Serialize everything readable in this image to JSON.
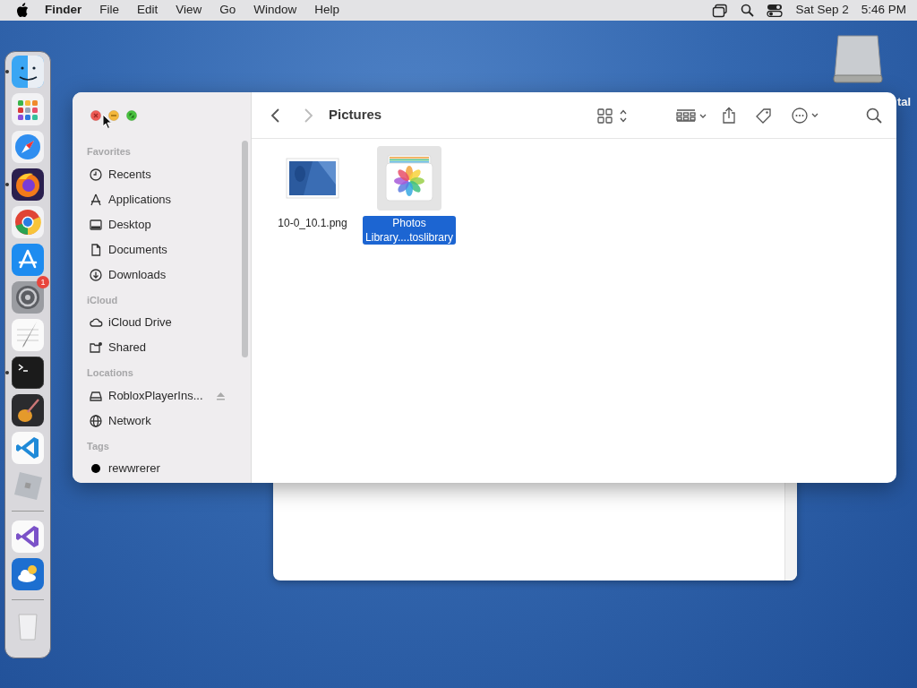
{
  "menu_bar": {
    "app_name": "Finder",
    "menus": [
      "File",
      "Edit",
      "View",
      "Go",
      "Window",
      "Help"
    ],
    "date": "Sat Sep 2",
    "time": "5:46 PM"
  },
  "dock": {
    "items": [
      {
        "kind": "finder",
        "running": true
      },
      {
        "kind": "launchpad",
        "running": false
      },
      {
        "kind": "safari",
        "running": false
      },
      {
        "kind": "firefox",
        "running": true
      },
      {
        "kind": "chrome",
        "running": false
      },
      {
        "kind": "appstore",
        "running": false
      },
      {
        "kind": "settings",
        "running": false,
        "badge": "1"
      },
      {
        "kind": "textedit",
        "running": false
      },
      {
        "kind": "terminal",
        "running": true
      },
      {
        "kind": "guitar",
        "running": false
      },
      {
        "kind": "vscode",
        "running": false
      },
      {
        "kind": "roblox",
        "running": false
      },
      {
        "kind": "separator"
      },
      {
        "kind": "visualstudio",
        "running": false
      },
      {
        "kind": "weather",
        "running": false
      },
      {
        "kind": "separator"
      },
      {
        "kind": "trash",
        "running": false
      }
    ]
  },
  "desktop_icons": [
    {
      "label": "tal"
    }
  ],
  "finder": {
    "title": "Pictures",
    "back_enabled": true,
    "forward_enabled": false,
    "sidebar": [
      {
        "heading": "Favorites",
        "items": [
          {
            "label": "Recents",
            "ejectable": false
          },
          {
            "label": "Applications",
            "ejectable": false
          },
          {
            "label": "Desktop",
            "ejectable": false
          },
          {
            "label": "Documents",
            "ejectable": false
          },
          {
            "label": "Downloads",
            "ejectable": false
          }
        ]
      },
      {
        "heading": "iCloud",
        "items": [
          {
            "label": "iCloud Drive",
            "ejectable": false
          },
          {
            "label": "Shared",
            "ejectable": false
          }
        ]
      },
      {
        "heading": "Locations",
        "items": [
          {
            "label": "RobloxPlayerIns...",
            "ejectable": true
          },
          {
            "label": "Network",
            "ejectable": false
          }
        ]
      },
      {
        "heading": "Tags",
        "items": [
          {
            "label": "rewwrerer",
            "ejectable": false,
            "color": "#000000"
          }
        ]
      }
    ],
    "files": [
      {
        "name": "10-0_10.1.png",
        "selected": false
      },
      {
        "name": "Photos Library....toslibrary",
        "kind": "library",
        "selected": true
      }
    ]
  }
}
